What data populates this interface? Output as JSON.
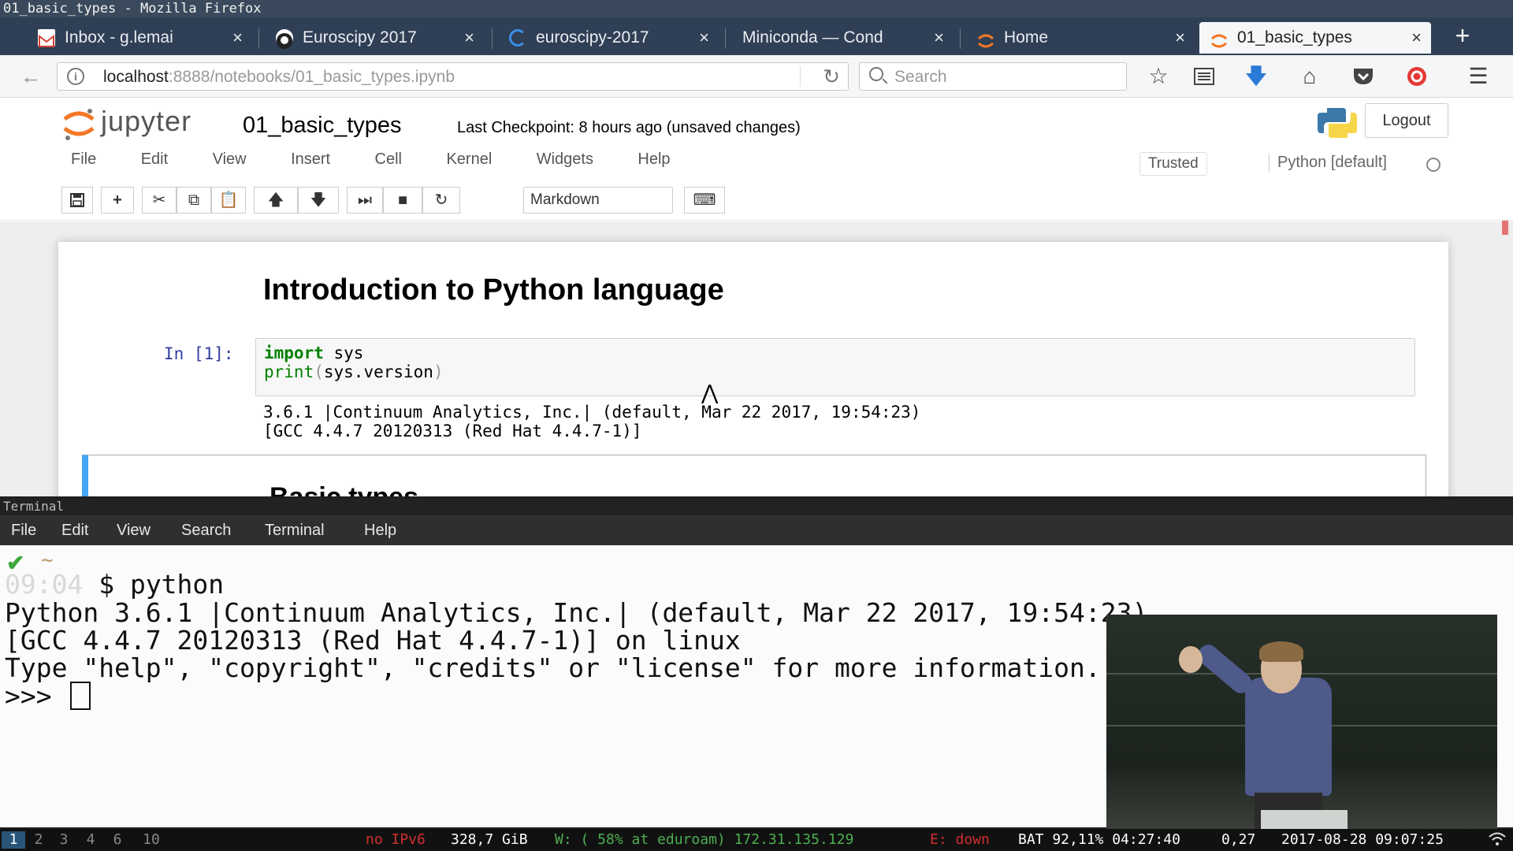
{
  "window_title": "01_basic_types - Mozilla Firefox",
  "tabs": [
    {
      "label": "Inbox - g.lemai",
      "icon": "gmail-icon",
      "color": "#d23f31"
    },
    {
      "label": "Euroscipy 2017",
      "icon": "github-icon",
      "color": "#222222"
    },
    {
      "label": "euroscipy-2017",
      "icon": "loading-icon",
      "color": "#3a8eea"
    },
    {
      "label": "Miniconda — Cond",
      "icon": "",
      "color": ""
    },
    {
      "label": "Home",
      "icon": "jupyter-icon",
      "color": "#f37726"
    },
    {
      "label": "01_basic_types",
      "icon": "jupyter-icon",
      "color": "#f37726",
      "active": true
    }
  ],
  "tab_close": "×",
  "new_tab": "+",
  "url": {
    "host": "localhost",
    "path": ":8888/notebooks/01_basic_types.ipynb"
  },
  "search_placeholder": "Search",
  "jupyter": {
    "logo_text": "jupyter",
    "notebook_name": "01_basic_types",
    "checkpoint": "Last Checkpoint: 8 hours ago (unsaved changes)",
    "logout": "Logout",
    "menu": [
      "File",
      "Edit",
      "View",
      "Insert",
      "Cell",
      "Kernel",
      "Widgets",
      "Help"
    ],
    "trusted": "Trusted",
    "kernel": "Python [default]",
    "cell_type": "Markdown"
  },
  "notebook": {
    "heading": "Introduction to Python language",
    "prompt": "In [1]:",
    "code_import_kw": "import",
    "code_import_rest": " sys",
    "code_print_fn": "print",
    "code_print_rest": "sys.version",
    "output_1": "3.6.1 |Continuum Analytics, Inc.| (default, Mar 22 2017, 19:54:23)",
    "output_2": "[GCC 4.4.7 20120313 (Red Hat 4.4.7-1)]",
    "next_heading": "Basic types"
  },
  "terminal": {
    "title": "Terminal",
    "menu": [
      "File",
      "Edit",
      "View",
      "Search",
      "Terminal",
      "Help"
    ],
    "tilde": "~",
    "time": "09:04",
    "command": " $ python",
    "line_1": "Python 3.6.1 |Continuum Analytics, Inc.| (default, Mar 22 2017, 19:54:23)",
    "line_2": "[GCC 4.4.7 20120313 (Red Hat 4.4.7-1)] on linux",
    "line_3": "Type \"help\", \"copyright\", \"credits\" or \"license\" for more information.",
    "prompt": ">>> "
  },
  "statusbar": {
    "workspaces": [
      "1",
      "2",
      "3",
      "4",
      "6",
      "10"
    ],
    "active_workspace": "1",
    "ipv6": "no IPv6",
    "disk": "328,7 GiB",
    "wifi": "W: ( 58% at eduroam) 172.31.135.129",
    "eth": "E: down",
    "battery": "BAT 92,11% 04:27:40",
    "load": "0,27",
    "datetime": "2017-08-28 09:07:25"
  }
}
